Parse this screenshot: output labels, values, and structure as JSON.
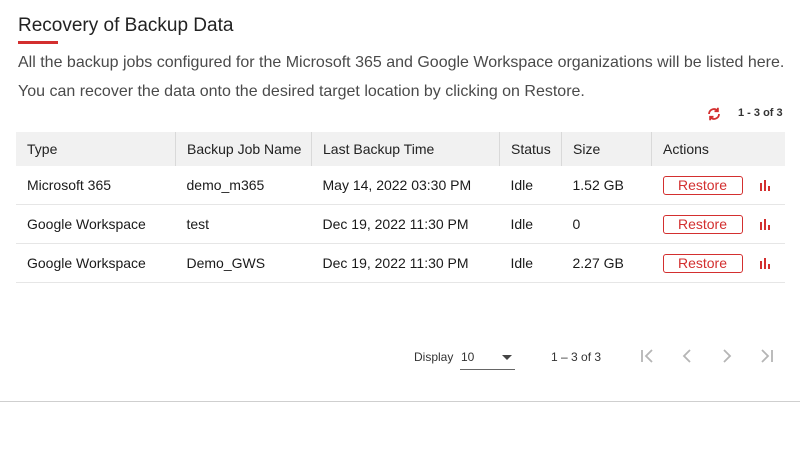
{
  "header": {
    "title": "Recovery of Backup Data",
    "description": "All the backup jobs configured for the Microsoft 365 and Google Workspace organizations will be listed here. You can recover the data onto the desired target location by clicking on Restore."
  },
  "toolbar": {
    "refresh_icon": "refresh-icon",
    "count_label": "1 - 3 of 3"
  },
  "table": {
    "columns": [
      "Type",
      "Backup Job Name",
      "Last Backup Time",
      "Status",
      "Size",
      "Actions"
    ],
    "rows": [
      {
        "type": "Microsoft 365",
        "name": "demo_m365",
        "time": "May 14, 2022 03:30 PM",
        "status": "Idle",
        "size": "1.52 GB",
        "action": "Restore"
      },
      {
        "type": "Google Workspace",
        "name": "test",
        "time": "Dec 19, 2022 11:30 PM",
        "status": "Idle",
        "size": "0",
        "action": "Restore"
      },
      {
        "type": "Google Workspace",
        "name": "Demo_GWS",
        "time": "Dec 19, 2022 11:30 PM",
        "status": "Idle",
        "size": "2.27 GB",
        "action": "Restore"
      }
    ]
  },
  "pagination": {
    "display_label": "Display",
    "page_size": "10",
    "range": "1 – 3 of 3",
    "icons": [
      "first-page-icon",
      "previous-page-icon",
      "next-page-icon",
      "last-page-icon"
    ]
  },
  "colors": {
    "accent": "#d32f2f",
    "header_bg": "#f1f1f1",
    "disabled_nav": "#b5b5b5"
  }
}
